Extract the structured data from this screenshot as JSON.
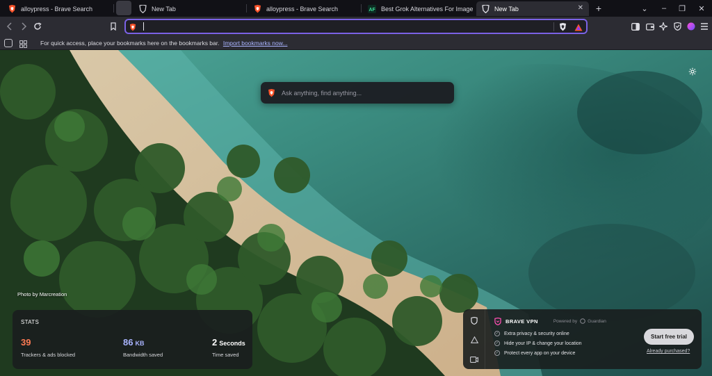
{
  "tabs": [
    {
      "label": "alloypress - Brave Search",
      "favicon": "brave-lion-icon",
      "active": false
    },
    {
      "label": "New Tab",
      "favicon": "brave-shield-icon",
      "active": false
    },
    {
      "label": "alloypress - Brave Search",
      "favicon": "brave-lion-icon",
      "active": false
    },
    {
      "label": "Best Grok Alternatives For Image & V",
      "favicon": "site-favicon-icon",
      "active": false
    },
    {
      "label": "New Tab",
      "favicon": "brave-shield-icon",
      "active": true
    }
  ],
  "window_controls": {
    "new_tab": "+",
    "dropdown": "⌄",
    "minimize": "–",
    "maximize": "❐",
    "close": "✕"
  },
  "address_bar": {
    "value": "",
    "placeholder": ""
  },
  "bookmarks_bar": {
    "message": "For quick access, place your bookmarks here on the bookmarks bar.",
    "import_link": "Import bookmarks now..."
  },
  "new_tab_page": {
    "search_placeholder": "Ask anything, find anything...",
    "photo_credit": "Photo by Marcreation",
    "stats": {
      "title": "STATS",
      "trackers_value": "39",
      "trackers_label": "Trackers & ads blocked",
      "bandwidth_value": "86",
      "bandwidth_unit": "KB",
      "bandwidth_label": "Bandwidth saved",
      "time_value": "2",
      "time_unit": "Seconds",
      "time_label": "Time saved"
    },
    "vpn": {
      "title": "BRAVE VPN",
      "powered_by": "Powered by",
      "provider": "Guardian",
      "features": [
        "Extra privacy & security online",
        "Hide your IP & change your location",
        "Protect every app on your device"
      ],
      "cta": "Start free trial",
      "already_purchased": "Already purchased?"
    }
  },
  "colors": {
    "accent": "#7b62e6",
    "brave_orange": "#fb542b",
    "trackers": "#ff7b54",
    "bandwidth": "#a9b4ff"
  }
}
